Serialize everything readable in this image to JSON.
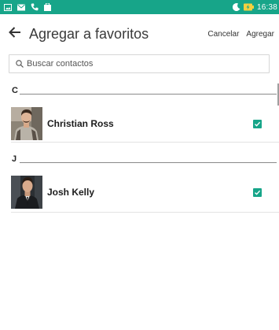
{
  "status_bar": {
    "time": "16:38",
    "left_icons": [
      "picture-icon",
      "message-icon",
      "phone-icon",
      "briefcase-icon"
    ],
    "right_icons": [
      "moon-icon",
      "battery-charging-icon"
    ],
    "background": "#17a589"
  },
  "app_bar": {
    "title": "Agregar a favoritos",
    "cancel_label": "Cancelar",
    "add_label": "Agregar"
  },
  "search": {
    "placeholder": "Buscar contactos",
    "value": ""
  },
  "sections": [
    {
      "letter": "C",
      "contacts": [
        {
          "name": "Christian Ross",
          "checked": true,
          "avatar": "person-photo"
        }
      ]
    },
    {
      "letter": "J",
      "contacts": [
        {
          "name": "Josh Kelly",
          "checked": true,
          "avatar": "person-photo"
        }
      ]
    }
  ],
  "colors": {
    "accent": "#17a589",
    "text_primary": "#1c1c1c",
    "divider": "#e3e3e3"
  }
}
